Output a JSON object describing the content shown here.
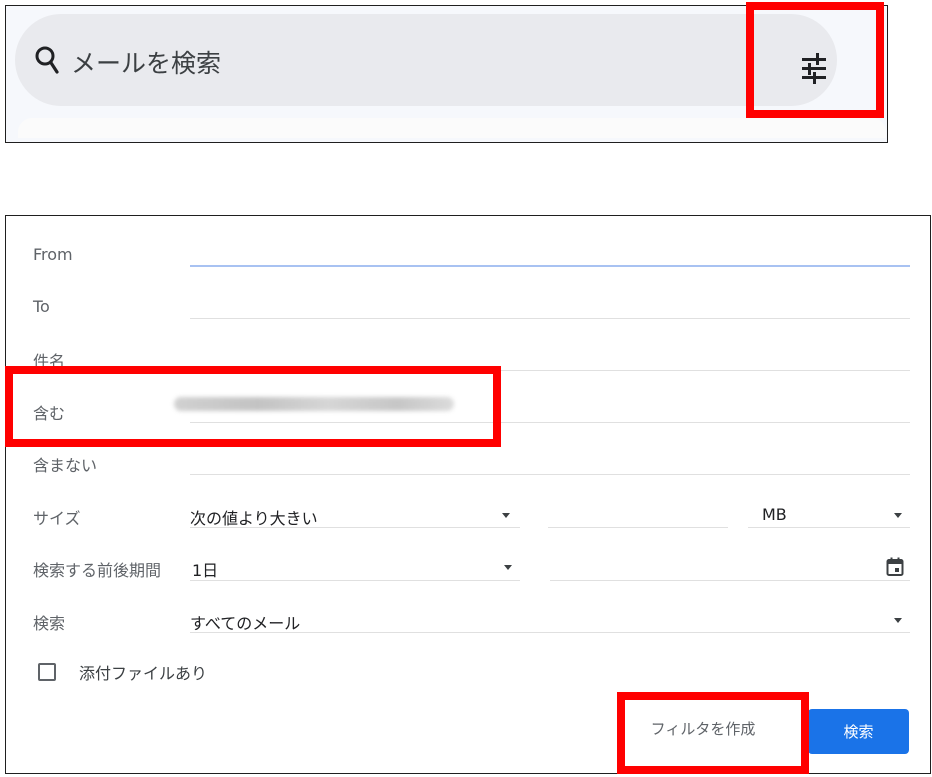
{
  "search_bar": {
    "placeholder": "メールを検索",
    "search_icon": "search-icon",
    "options_icon": "tune-icon"
  },
  "advanced_search": {
    "from_label": "From",
    "to_label": "To",
    "subject_label": "件名",
    "has_words_label": "含む",
    "has_words_value": "yuko_sasaki@digitalbank.co.jp",
    "doesnt_have_label": "含まない",
    "size_label": "サイズ",
    "size_operator": "次の値より大きい",
    "size_unit": "MB",
    "date_within_label": "検索する前後期間",
    "date_within_value": "1日",
    "search_label": "検索",
    "search_scope": "すべてのメール",
    "has_attachment_label": "添付ファイルあり",
    "create_filter_button": "フィルタを作成",
    "search_button": "検索"
  },
  "colors": {
    "accent_blue": "#1a73e8",
    "highlight_red": "#ff0000",
    "active_underline": "#a8c2f2"
  }
}
